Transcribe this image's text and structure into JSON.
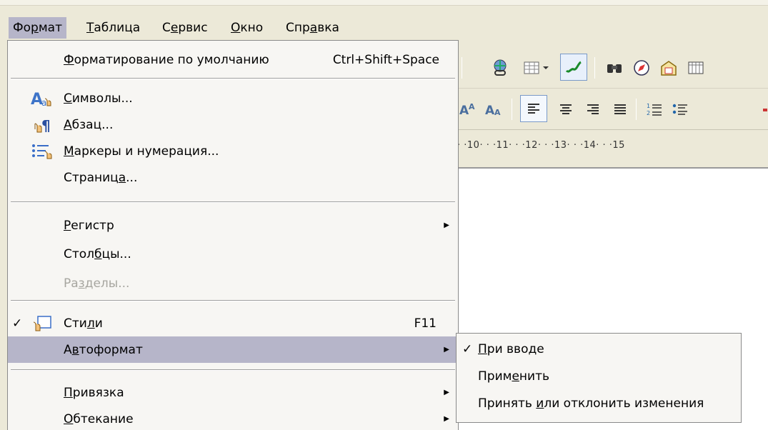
{
  "menubar": {
    "items": [
      {
        "label": "Формат",
        "ul": 2
      },
      {
        "label": "Таблица",
        "ul": 0
      },
      {
        "label": "Сервис",
        "ul": 1
      },
      {
        "label": "Окно",
        "ul": 0
      },
      {
        "label": "Справка",
        "ul": 3
      }
    ]
  },
  "format_menu": {
    "default_formatting": {
      "label": "Форматирование по умолчанию",
      "shortcut": "Ctrl+Shift+Space",
      "ul": 0
    },
    "characters": {
      "label": "Символы...",
      "ul": 0,
      "icon": "character-format-icon"
    },
    "paragraph": {
      "label": "Абзац...",
      "ul": 0,
      "icon": "paragraph-format-icon"
    },
    "bullets": {
      "label": "Маркеры и нумерация...",
      "ul": 0,
      "icon": "bullets-numbering-icon"
    },
    "page": {
      "label": "Страница...",
      "ul": 7
    },
    "case": {
      "label": "Регистр",
      "ul": 0
    },
    "columns": {
      "label": "Столбцы...",
      "ul": 4
    },
    "sections": {
      "label": "Разделы...",
      "ul": 2
    },
    "styles": {
      "label": "Стили",
      "shortcut": "F11",
      "ul": 3,
      "icon": "styles-icon",
      "checked": true
    },
    "autoformat": {
      "label": "Автоформат",
      "ul": 1
    },
    "anchor": {
      "label": "Привязка",
      "ul": 0
    },
    "wrap": {
      "label": "Обтекание",
      "ul": 0
    }
  },
  "autoformat_submenu": {
    "while_typing": {
      "label": "При вводе",
      "checked": true
    },
    "apply": {
      "label": "Применить"
    },
    "apply_and_edit": {
      "label": "Принять или отклонить изменения"
    }
  },
  "ruler": {
    "text": "· ·10· · ·11· · ·12· · ·13· · ·14· · ·15"
  },
  "colors": {
    "highlight": "#b6b5c9",
    "menu_bg": "#f7f6f3",
    "toolbar_bg": "#ece9d8"
  }
}
